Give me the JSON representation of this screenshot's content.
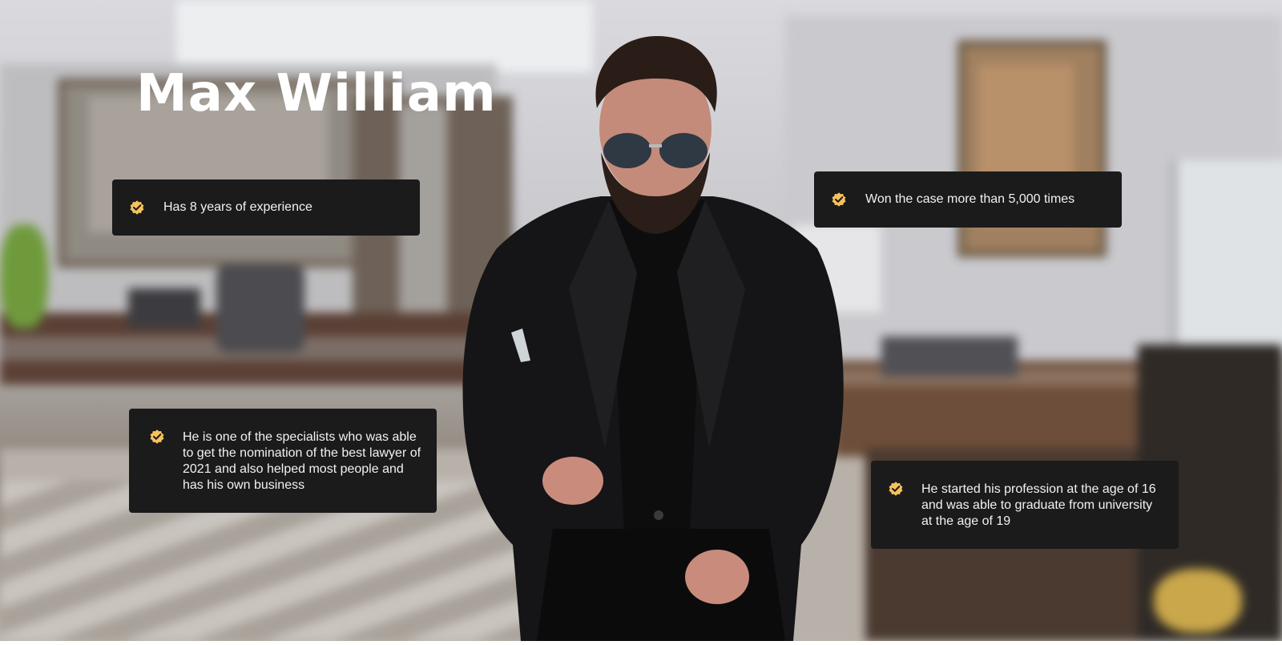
{
  "hero": {
    "title": "Max William",
    "accent_color": "#f6c25a",
    "card_background": "#1b1b1c",
    "badge_icon": "verified-check-badge-icon",
    "highlights": [
      {
        "text": "Has 8 years of experience"
      },
      {
        "text": "Won the case more than 5,000 times"
      },
      {
        "text": "He is one of the specialists who was able to get the nomination of the best lawyer of 2021 and also helped most people and has his own business"
      },
      {
        "text": "He started his profession at the age of 16 and was able to graduate from university at the age of 19"
      }
    ]
  }
}
